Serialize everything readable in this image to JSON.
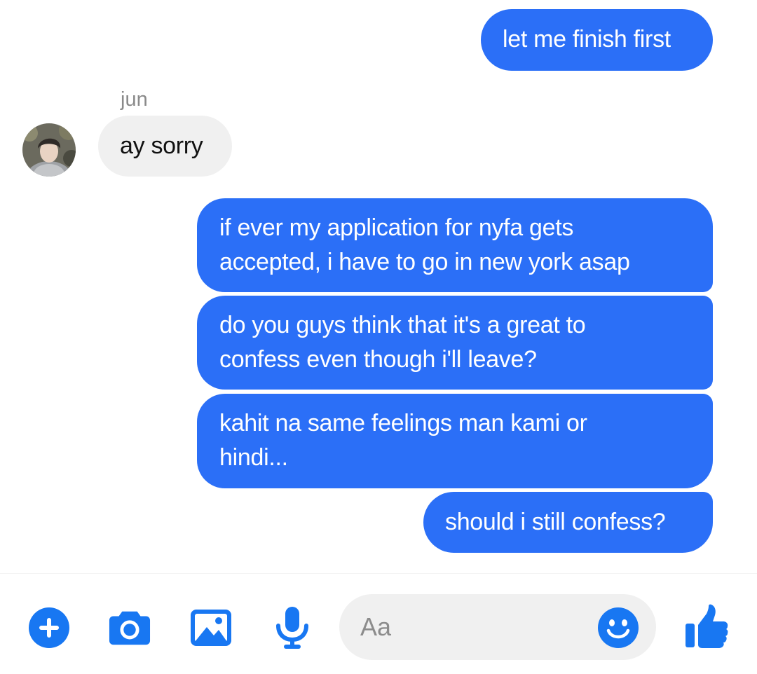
{
  "conversation": {
    "messages": [
      {
        "direction": "outgoing",
        "text": "let me finish first"
      },
      {
        "direction": "incoming",
        "sender": "jun",
        "text": "ay sorry"
      },
      {
        "direction": "outgoing",
        "lines": [
          "if ever my application for nyfa gets",
          "accepted, i have to go in new york asap"
        ]
      },
      {
        "direction": "outgoing",
        "lines": [
          "do you guys think that it's a great to",
          "confess even though i'll leave?"
        ]
      },
      {
        "direction": "outgoing",
        "lines": [
          "kahit na same feelings man kami or",
          "hindi..."
        ]
      },
      {
        "direction": "outgoing",
        "text": "should i still confess?"
      }
    ]
  },
  "composer": {
    "placeholder": "Aa",
    "buttons": {
      "add": "plus-icon",
      "camera": "camera-icon",
      "gallery": "image-icon",
      "voice": "microphone-icon",
      "emoji": "smiley-icon",
      "like": "thumbs-up-icon"
    }
  },
  "colors": {
    "accent": "#2b6ff7",
    "outgoing_bubble": "#2b6ff7",
    "incoming_bubble": "#f0f0f0",
    "composer_icon": "#1877f2",
    "field_background": "#f0f0f0",
    "sender_name": "#8a8a8a"
  }
}
